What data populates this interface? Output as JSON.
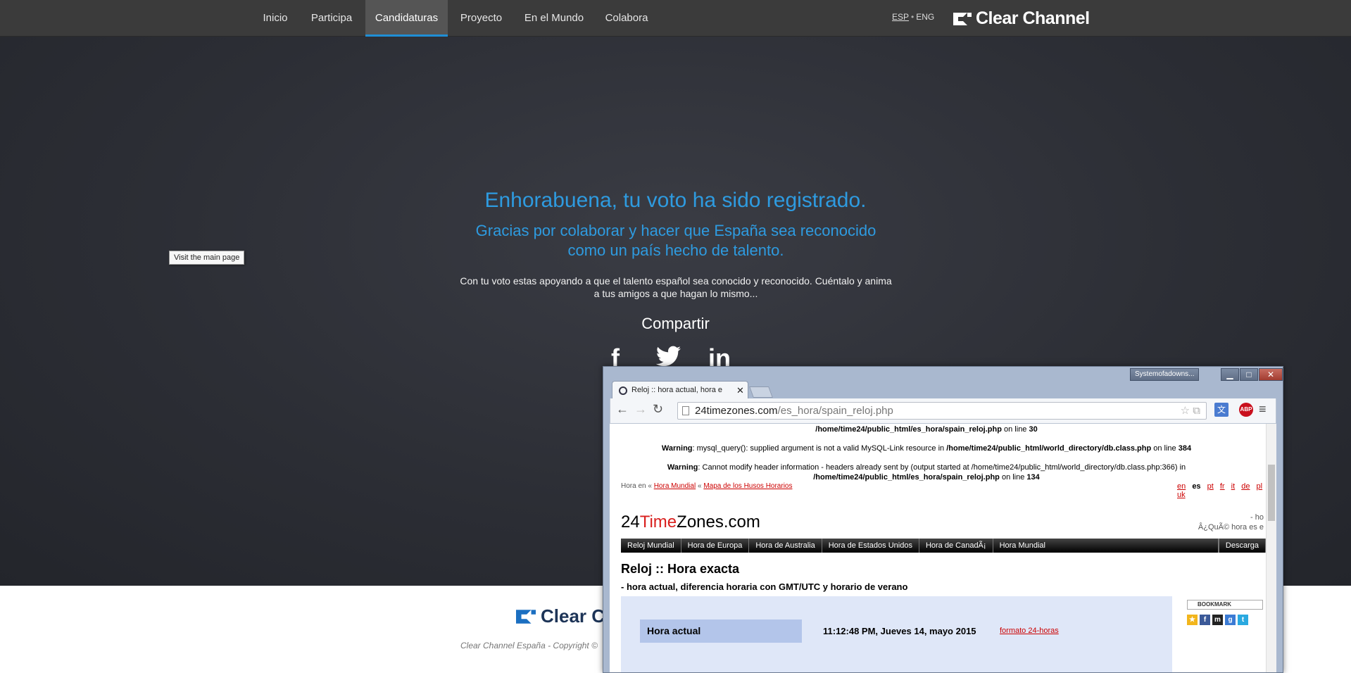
{
  "nav": {
    "items": [
      "Inicio",
      "Participa",
      "Candidaturas",
      "Proyecto",
      "En el Mundo",
      "Colabora"
    ],
    "lang_esp": "ESP",
    "lang_eng": "ENG",
    "brand": "Clear Channel"
  },
  "main": {
    "headline": "Enhorabuena, tu voto ha sido registrado.",
    "subhead_line1": "Gracias por colaborar y hacer que España sea reconocido",
    "subhead_line2": "como un país hecho de talento.",
    "body_line1": "Con tu voto estas apoyando a que el talento español sea conocido y reconocido. Cuéntalo y anima",
    "body_line2": "a tus amigos a que hagan lo mismo...",
    "share_title": "Compartir",
    "social": [
      "f",
      "t",
      "in"
    ],
    "tooltip": "Visit the main page"
  },
  "footer": {
    "brand": "Clear C",
    "copyright": "Clear Channel España - Copyright ©"
  },
  "browser": {
    "profile": "Systemofadowns...",
    "tab_title": "Reloj :: hora actual, hora e",
    "url_domain": "24timezones.com",
    "url_path": "/es_hora/spain_reloj.php",
    "warnings": {
      "w0_path": "/home/time24/public_html/es_hora/spain_reloj.php",
      "w0_line": "30",
      "w1_label": "Warning",
      "w1_text": ": mysql_query(): supplied argument is not a valid MySQL-Link resource in ",
      "w1_path": "/home/time24/public_html/world_directory/db.class.php",
      "w1_line": "384",
      "w2_label": "Warning",
      "w2_text": ": Cannot modify header information - headers already sent by (output started at /home/time24/public_html/world_directory/db.class.php:366) in",
      "w2_path": "/home/time24/public_html/es_hora/spain_reloj.php",
      "w2_line": "134",
      "on_line": " on line "
    },
    "hora_en": "Hora en",
    "crumb1": "Hora Mundial",
    "crumb2": "Mapa de los Husos Horarios",
    "langs": [
      "en",
      "es",
      "pt",
      "fr",
      "it",
      "de",
      "pl",
      "uk"
    ],
    "site_title_a": "24",
    "site_title_b": "Time",
    "site_title_c": "Zones.com",
    "side_note1": "- ho",
    "side_note2": "Â¿QuÃ© hora es e",
    "menu": [
      "Reloj Mundial",
      "Hora de Europa",
      "Hora de Australia",
      "Hora de Estados Unidos",
      "Hora de CanadÃ¡",
      "Hora Mundial",
      "Descarga"
    ],
    "h1": "Reloj :: Hora exacta",
    "h2": "- hora actual, diferencia horaria con GMT/UTC y horario de verano",
    "time_label": "Hora actual",
    "time_value": "11:12:48 PM, Jueves 14, mayo 2015",
    "time_format": "formato 24-horas",
    "bookmark": "BOOKMARK"
  },
  "colors": {
    "accent_blue": "#2e9be0",
    "nav_bg": "#3b3b3b",
    "error_red": "#cc0000"
  }
}
